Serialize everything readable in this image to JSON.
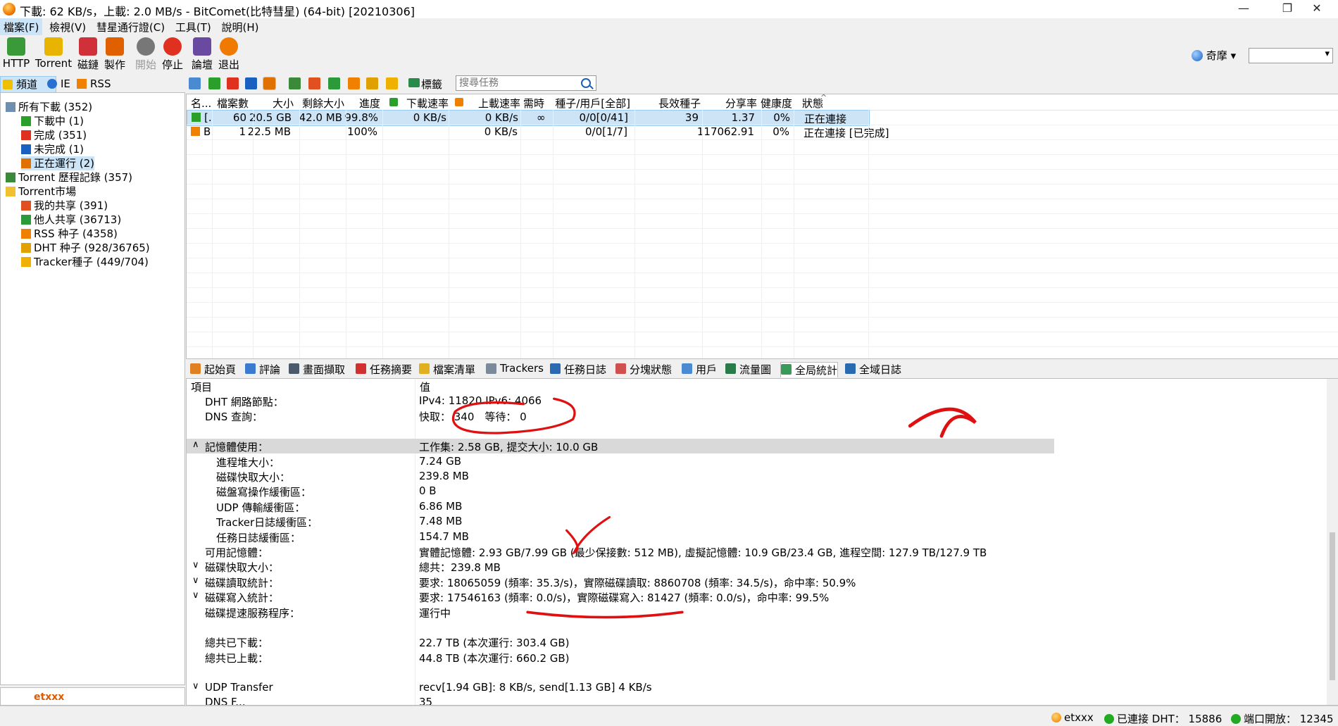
{
  "window": {
    "title": "下載: 62 KB/s，上載: 2.0 MB/s - BitComet(比特彗星) (64-bit) [20210306]",
    "minimize_glyph": "—",
    "maximize_glyph": "❐",
    "close_glyph": "✕"
  },
  "menu": [
    "檔案(F)",
    "檢視(V)",
    "彗星通行證(C)",
    "工具(T)",
    "說明(H)"
  ],
  "toolbar": {
    "buttons": [
      {
        "label": "HTTP",
        "icon": "http-add-icon",
        "color": "#3a9a3a"
      },
      {
        "label": "Torrent",
        "icon": "torrent-open-icon",
        "color": "#e8b400"
      },
      {
        "label": "磁鏈",
        "icon": "magnet-icon",
        "color": "#d0303a"
      },
      {
        "label": "製作",
        "icon": "make-torrent-icon",
        "color": "#e06000"
      },
      {
        "label": "開始",
        "icon": "start-icon",
        "color": "#777777"
      },
      {
        "label": "停止",
        "icon": "stop-icon",
        "color": "#e03020"
      },
      {
        "label": "論壇",
        "icon": "forum-icon",
        "color": "#6a4aa0"
      },
      {
        "label": "退出",
        "icon": "exit-icon",
        "color": "#f07a00"
      }
    ],
    "user": "奇摩",
    "user_dropdown": "▾"
  },
  "left_tabs": [
    {
      "label": "頻道",
      "icon": "star-icon",
      "color": "#f0c000"
    },
    {
      "label": "IE",
      "icon": "ie-icon",
      "color": "#2a70d0"
    },
    {
      "label": "RSS",
      "icon": "rss-icon",
      "color": "#f08000"
    }
  ],
  "tree": [
    {
      "label": "所有下載 (352)",
      "icon": "all-downloads-icon",
      "color": "#6f8fb0"
    },
    {
      "label": "下載中 (1)",
      "icon": "downloading-icon",
      "color": "#2aa02a"
    },
    {
      "label": "完成 (351)",
      "icon": "completed-check-icon",
      "color": "#e03020"
    },
    {
      "label": "未完成 (1)",
      "icon": "incomplete-icon",
      "color": "#1a60c0"
    },
    {
      "label": "正在運行 (2)",
      "icon": "running-icon",
      "color": "#e07000"
    },
    {
      "label": "Torrent 歷程記錄 (357)",
      "icon": "history-icon",
      "color": "#3a8a3a"
    },
    {
      "label": "Torrent市場",
      "icon": "folder-icon",
      "color": "#f0c030"
    },
    {
      "label": "我的共享 (391)",
      "icon": "my-share-icon",
      "color": "#e05020"
    },
    {
      "label": "他人共享 (36713)",
      "icon": "others-share-icon",
      "color": "#2a9a3a"
    },
    {
      "label": "RSS 种子 (4358)",
      "icon": "rss-seed-icon",
      "color": "#f08000"
    },
    {
      "label": "DHT 种子 (928/36765)",
      "icon": "dht-seed-icon",
      "color": "#e0a000"
    },
    {
      "label": "Tracker種子 (449/704)",
      "icon": "tracker-seed-icon",
      "color": "#f0b000"
    }
  ],
  "left_footer": "etxxx",
  "task_toolbar": {
    "tag_label": "標籤",
    "search_placeholder": "搜尋任務"
  },
  "task_columns": [
    "名...",
    "檔案數",
    "大小",
    "剩餘大小",
    "進度",
    "下載速率",
    "上載速率",
    "需時",
    "種子/用戶[全部]",
    "長效種子",
    "分享率",
    "健康度",
    "狀態"
  ],
  "sort_glyph": "^",
  "tasks": [
    {
      "name": "[.",
      "files": "60",
      "size": "20.5 GB",
      "remaining": "42.0 MB",
      "progress": "99.8%",
      "down": "0 KB/s",
      "up": "0 KB/s",
      "eta": "∞",
      "peers": "0/0[0/41]",
      "long_seeds": "39",
      "ratio": "1.37",
      "health": "0%",
      "status": "正在連接"
    },
    {
      "name": "B",
      "files": "1",
      "size": "22.5 MB",
      "remaining": "",
      "progress": "100%",
      "down": "",
      "up": "0 KB/s",
      "eta": "",
      "peers": "0/0[1/7]",
      "long_seeds": "",
      "ratio": "117062.91",
      "health": "0%",
      "status": "正在連接 [已完成]"
    }
  ],
  "bottom_tabs": [
    {
      "label": "起始頁",
      "icon": "home-page-icon",
      "color": "#e08020"
    },
    {
      "label": "評論",
      "icon": "comment-icon",
      "color": "#3a7ad0"
    },
    {
      "label": "畫面擷取",
      "icon": "screenshot-icon",
      "color": "#4a5a6a"
    },
    {
      "label": "任務摘要",
      "icon": "task-summary-icon",
      "color": "#d03030"
    },
    {
      "label": "檔案清單",
      "icon": "file-list-icon",
      "color": "#e0b020"
    },
    {
      "label": "Trackers",
      "icon": "trackers-icon",
      "color": "#7a8a9a"
    },
    {
      "label": "任務日誌",
      "icon": "task-log-icon",
      "color": "#2a6ab0"
    },
    {
      "label": "分塊狀態",
      "icon": "piece-status-icon",
      "color": "#d05050"
    },
    {
      "label": "用戶",
      "icon": "peers-icon",
      "color": "#4a8ad0"
    },
    {
      "label": "流量圖",
      "icon": "traffic-chart-icon",
      "color": "#2a7a4a"
    },
    {
      "label": "全局統計",
      "icon": "global-stats-icon",
      "color": "#3a9a5a"
    },
    {
      "label": "全域日誌",
      "icon": "global-log-icon",
      "color": "#2a6ab0"
    }
  ],
  "stats": {
    "header_label": "項目",
    "header_value": "值",
    "rows": [
      {
        "label": "DHT 網路節點：",
        "value": "IPv4: 11820 IPv6: 4066",
        "indent": 1,
        "expander": ""
      },
      {
        "label": "DNS 查詢：",
        "value": "快取： 340　等待： 0",
        "indent": 1,
        "expander": ""
      },
      {
        "label": "",
        "value": "",
        "indent": 1,
        "expander": ""
      },
      {
        "label": "記憶體使用：",
        "value": "工作集: 2.58 GB, 提交大小: 10.0 GB",
        "indent": 1,
        "expander": "∧"
      },
      {
        "label": "進程堆大小：",
        "value": "7.24 GB",
        "indent": 2,
        "expander": ""
      },
      {
        "label": "磁碟快取大小：",
        "value": "239.8 MB",
        "indent": 2,
        "expander": ""
      },
      {
        "label": "磁盤寫操作緩衝區：",
        "value": "0 B",
        "indent": 2,
        "expander": ""
      },
      {
        "label": "UDP 傳輸緩衝區：",
        "value": "6.86 MB",
        "indent": 2,
        "expander": ""
      },
      {
        "label": "Tracker日誌緩衝區：",
        "value": "7.48 MB",
        "indent": 2,
        "expander": ""
      },
      {
        "label": "任務日誌緩衝區：",
        "value": "154.7 MB",
        "indent": 2,
        "expander": ""
      },
      {
        "label": "可用記憶體：",
        "value": "實體記憶體: 2.93 GB/7.99 GB (最少保接數: 512 MB), 虛擬記憶體: 10.9 GB/23.4 GB, 進程空間: 127.9 TB/127.9 TB",
        "indent": 1,
        "expander": ""
      },
      {
        "label": "磁碟快取大小：",
        "value": "總共：239.8 MB",
        "indent": 1,
        "expander": "∨"
      },
      {
        "label": "磁碟讀取統計：",
        "value": "要求: 18065059 (頻率: 35.3/s)，實際磁碟讀取: 8860708 (頻率: 34.5/s)，命中率: 50.9%",
        "indent": 1,
        "expander": "∨"
      },
      {
        "label": "磁碟寫入統計：",
        "value": "要求: 17546163 (頻率: 0.0/s)，實際磁碟寫入: 81427 (頻率: 0.0/s)，命中率: 99.5%",
        "indent": 1,
        "expander": "∨"
      },
      {
        "label": "磁碟提速服務程序：",
        "value": "運行中",
        "indent": 1,
        "expander": ""
      },
      {
        "label": "",
        "value": "",
        "indent": 1,
        "expander": ""
      },
      {
        "label": "總共已下載：",
        "value": "22.7 TB (本次運行: 303.4 GB)",
        "indent": 1,
        "expander": ""
      },
      {
        "label": "總共已上載：",
        "value": "44.8 TB (本次運行: 660.2 GB)",
        "indent": 1,
        "expander": ""
      },
      {
        "label": "",
        "value": "",
        "indent": 1,
        "expander": ""
      },
      {
        "label": "UDP Transfer",
        "value": "recv[1.94 GB]: 8 KB/s, send[1.13 GB] 4 KB/s",
        "indent": 1,
        "expander": "∨"
      },
      {
        "label": "DNS F...",
        "value": "35",
        "indent": 1,
        "expander": ""
      }
    ]
  },
  "statusbar": {
    "user": "etxxx",
    "dht": "已連接 DHT： 15886",
    "port": "端口開放： 12345"
  },
  "colors": {
    "annotation_red": "#e01010",
    "selection": "#cde3f6",
    "status_ok": "#22aa22"
  }
}
